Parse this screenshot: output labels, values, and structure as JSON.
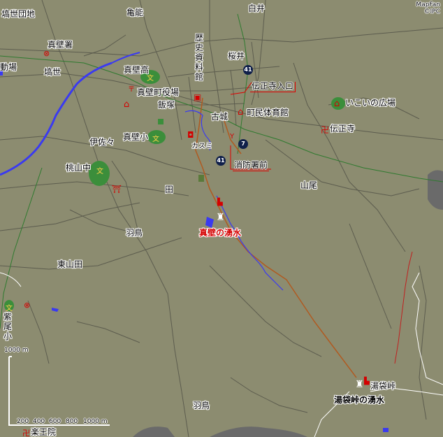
{
  "credit": {
    "line1": "MapFan",
    "line2": "©IPC"
  },
  "places": {
    "hanawa_danchi": "塙世団地",
    "kamenou": "亀能",
    "shirai": "白井",
    "makabe_sho": "真壁署",
    "jo": "動場",
    "hanawa": "塙世",
    "makabe_ko": "真壁高",
    "sakurai": "桜井",
    "rekishi_shiryokan": "歴史資料館",
    "makabe_yakuba": "真壁町役場",
    "iizuka": "飯塚",
    "denshoji_iriguchi": "伝正寺入口",
    "furushiro": "古城",
    "chomin_taiikukan": "町民体育館",
    "ikoi_hiroba": "いこいの広場",
    "denshoji": "伝正寺",
    "makabe_sho_school": "真壁小",
    "isasa": "伊佐々",
    "kasumi": "カスミ",
    "momoyama_chu": "桃山中",
    "shobosho_mae": "消防署前",
    "den": "田",
    "sanbi": "山尾",
    "makabe_wakimizu": "真壁の湧水",
    "hatori": "羽鳥",
    "higashiyamada": "東山田",
    "shibio_sho": "紫尾小",
    "yubukurotoge": "湯袋峠",
    "yubukurotoge_wakimizu": "湯袋峠の湧水",
    "hatori2": "羽鳥",
    "jotoin": "楽王院"
  },
  "routes": {
    "r41a": "41",
    "r41b": "41",
    "r7": "7"
  },
  "scale": {
    "top_label": "1000 m",
    "ticks": [
      "200",
      "400",
      "600",
      "800",
      "1000 m"
    ]
  },
  "colors": {
    "land": "#8c8c70",
    "river": "#3a3af0",
    "road_main": "#b05a20",
    "park": "#3b8e3b",
    "highlight": "#e00000"
  }
}
